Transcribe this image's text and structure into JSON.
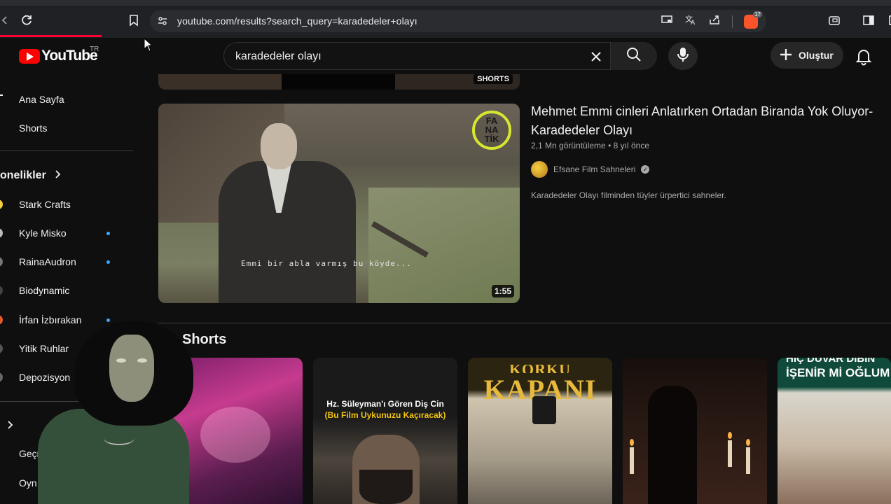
{
  "browser": {
    "url": "youtube.com/results?search_query=karadedeler+olayı",
    "extension_badge": "17",
    "icons": [
      "back-icon",
      "reload-icon",
      "bookmark-icon",
      "site-settings-icon",
      "cast-icon",
      "translate-icon",
      "share-icon",
      "brave-shield-icon",
      "wallet-icon",
      "sidebar-icon"
    ]
  },
  "header": {
    "logo_text": "YouTube",
    "country_code": "TR",
    "search_query": "karadedeler olayı",
    "create_label": "Oluştur"
  },
  "sidebar": {
    "items": [
      {
        "label": "Ana Sayfa"
      },
      {
        "label": "Shorts"
      }
    ],
    "subscriptions_title": "onelikler",
    "subscriptions": [
      {
        "label": "Stark Crafts",
        "dot": false,
        "color": "#f4d03f"
      },
      {
        "label": "Kyle Misko",
        "dot": true,
        "color": "#bbbbbb"
      },
      {
        "label": "RainaAudron",
        "dot": true,
        "color": "#777777"
      },
      {
        "label": "Biodynamic",
        "dot": false,
        "color": "#444444"
      },
      {
        "label": "İrfan İzbırakan",
        "dot": true,
        "color": "#e05a2b"
      },
      {
        "label": "Yitik Ruhlar",
        "dot": false,
        "color": "#555555"
      },
      {
        "label": "Depozisyon",
        "dot": false,
        "color": "#666666"
      }
    ],
    "bottom_items": [
      {
        "label": "Geçr"
      },
      {
        "label": "Oyn"
      }
    ]
  },
  "previous_card": {
    "badge": "SHORTS"
  },
  "video": {
    "title": "Mehmet Emmi cinleri Anlatırken Ortadan Biranda Yok Oluyor- Karadedeler Olayı",
    "views": "2,1 Mn görüntüleme",
    "age": "8 yıl önce",
    "channel": "Efsane Film Sahneleri",
    "verified": true,
    "description": "Karadedeler Olayı filminden tüyler ürpertici sahneler.",
    "duration": "1:55",
    "thumbnail_subtitle": "Emmi bir abla varmış bu köyde...",
    "watermark": "FANATİK"
  },
  "shorts": {
    "title": "Shorts",
    "items": [
      {
        "caption_1": "",
        "caption_2": ""
      },
      {
        "caption_1": "Hz. Süleyman'ı Gören Diş Cin",
        "caption_2": "(Bu Film Uykunuzu Kaçıracak)"
      },
      {
        "caption_1": "KORKU",
        "caption_2": "KAPANI"
      },
      {
        "caption_1": "",
        "caption_2": ""
      },
      {
        "caption_1": "HİÇ DUVAR DİBİN",
        "caption_2": "İŞENİR Mİ OĞLUM"
      }
    ]
  },
  "colors": {
    "background": "#0f0f0f",
    "youtube_red": "#ff0000",
    "verified_gray": "#aaaaaa",
    "notification_dot": "#3ea6ff"
  }
}
